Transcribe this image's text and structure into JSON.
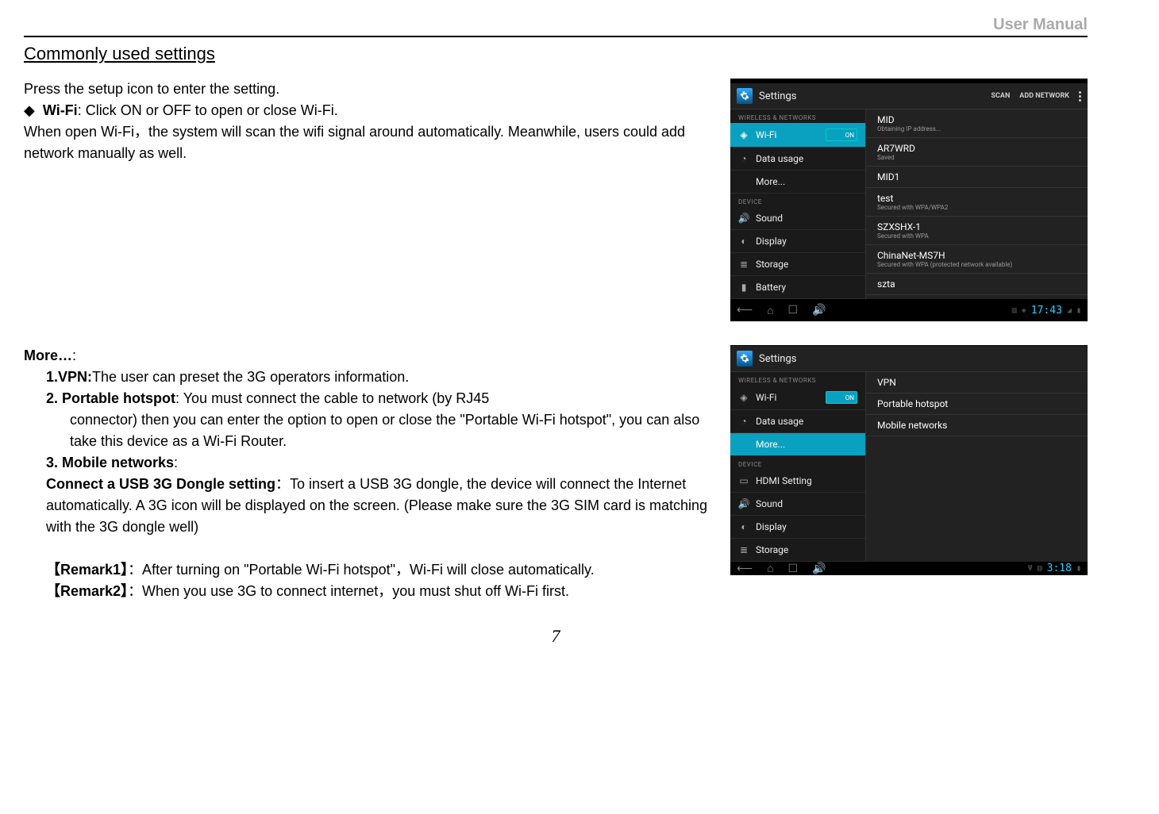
{
  "header": {
    "title": "User Manual"
  },
  "section_title": "Commonly used settings",
  "page_number": "7",
  "block1": {
    "line1": "Press the setup icon to enter the setting.",
    "bullet_label": "Wi-Fi",
    "bullet_rest": ": Click ON or OFF to open or close Wi-Fi.",
    "line3": "When open Wi-Fi，the system will scan the wifi signal around automatically. Meanwhile, users could add network manually as well."
  },
  "block2": {
    "more_label": "More…",
    "more_colon": ":",
    "vpn_label": "1.VPN:",
    "vpn_text": "The user can preset the 3G operators information.",
    "ph_label": "2. Portable hotspot",
    "ph_text_a": ": You must connect the cable to network (by RJ45",
    "ph_text_b": "connector) then you can enter the option to open or close the \"Portable Wi-Fi hotspot\", you can also take this device as a Wi-Fi Router.",
    "mn_label": "3. Mobile networks",
    "mn_colon": ":",
    "usb_label": "Connect a USB 3G Dongle setting",
    "usb_text": "：To insert a USB 3G dongle, the device will connect the Internet automatically. A 3G icon will be displayed on the screen. (Please make sure the 3G SIM card is matching with the 3G dongle well)",
    "remark1_label": "【Remark1】",
    "remark1_text": "：After turning on \"Portable Wi-Fi hotspot\"，Wi-Fi will close automatically.",
    "remark2_label": "【Remark2】",
    "remark2_text": "：When you use 3G to connect internet，you must shut off Wi-Fi first."
  },
  "shot1": {
    "title": "Settings",
    "actions": {
      "scan": "SCAN",
      "add": "ADD NETWORK"
    },
    "left_hdr1": "WIRELESS & NETWORKS",
    "left_hdr2": "DEVICE",
    "toggle": "ON",
    "left_items": {
      "wifi": "Wi-Fi",
      "data": "Data usage",
      "more": "More...",
      "sound": "Sound",
      "display": "Display",
      "storage": "Storage",
      "battery": "Battery"
    },
    "networks": [
      {
        "name": "MID",
        "sub": "Obtaining IP address..."
      },
      {
        "name": "AR7WRD",
        "sub": "Saved"
      },
      {
        "name": "MID1",
        "sub": ""
      },
      {
        "name": "test",
        "sub": "Secured with WPA/WPA2"
      },
      {
        "name": "SZXSHX-1",
        "sub": "Secured with WPA"
      },
      {
        "name": "ChinaNet-MS7H",
        "sub": "Secured with WPA (protected network available)"
      },
      {
        "name": "szta",
        "sub": ""
      }
    ],
    "clock": "17:43"
  },
  "shot2": {
    "title": "Settings",
    "left_hdr1": "WIRELESS & NETWORKS",
    "left_hdr2": "DEVICE",
    "toggle": "ON",
    "left_items": {
      "wifi": "Wi-Fi",
      "data": "Data usage",
      "more": "More...",
      "hdmi": "HDMI Setting",
      "sound": "Sound",
      "display": "Display",
      "storage": "Storage"
    },
    "right_items": {
      "vpn": "VPN",
      "hotspot": "Portable hotspot",
      "mobile": "Mobile networks"
    },
    "clock": "3:18"
  }
}
